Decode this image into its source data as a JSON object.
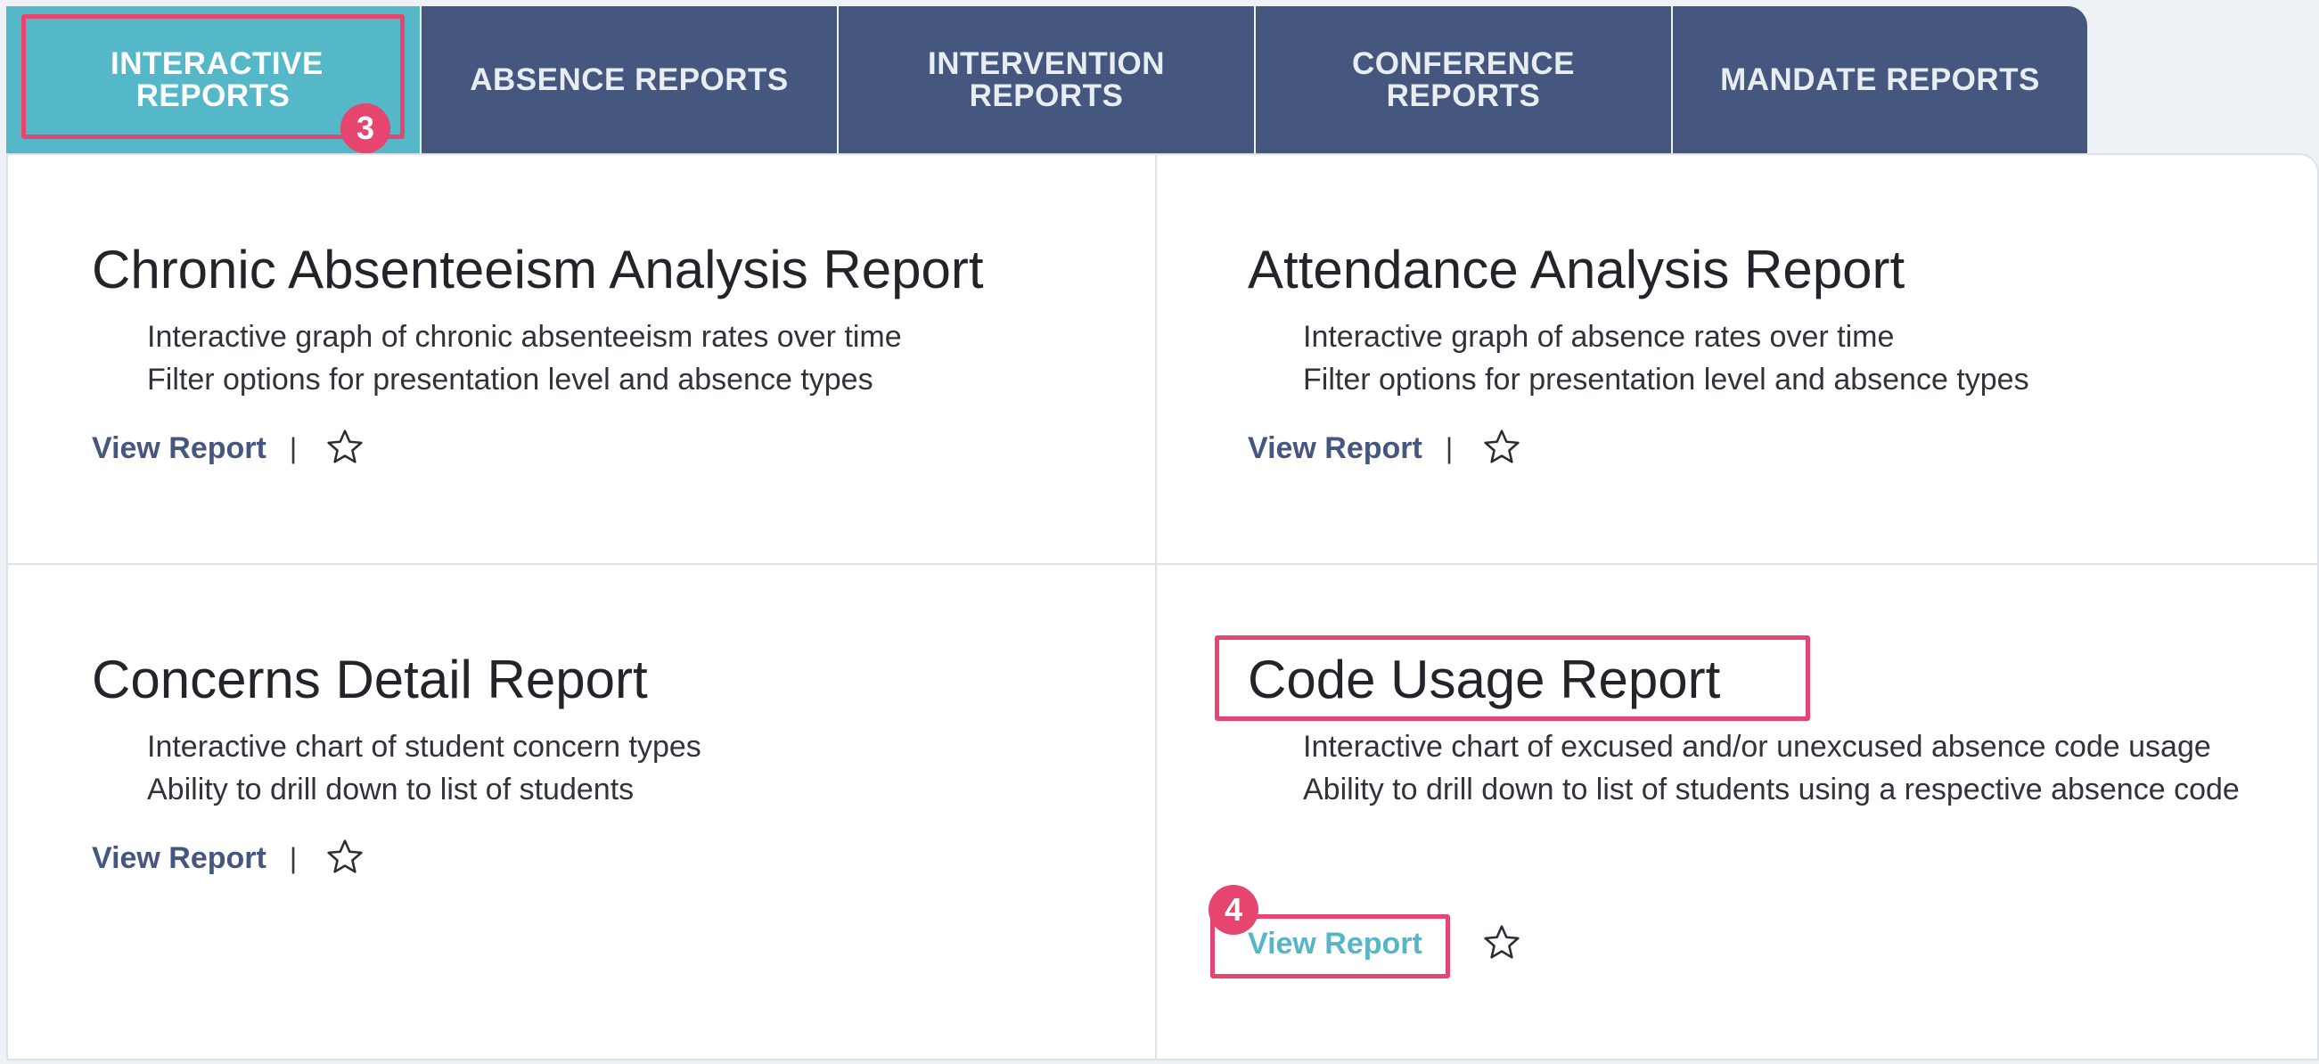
{
  "tabs": [
    {
      "label": "INTERACTIVE REPORTS"
    },
    {
      "label": "ABSENCE REPORTS"
    },
    {
      "label": "INTERVENTION REPORTS"
    },
    {
      "label": "CONFERENCE REPORTS"
    },
    {
      "label": "MANDATE REPORTS"
    }
  ],
  "reports": [
    {
      "title": "Chronic Absenteeism Analysis Report",
      "lines": [
        "Interactive graph of chronic absenteeism rates over time",
        "Filter options for presentation level and absence types"
      ],
      "link": "View Report",
      "separator": "|"
    },
    {
      "title": "Attendance Analysis Report",
      "lines": [
        "Interactive graph of absence rates over time",
        "Filter options for presentation level and absence types"
      ],
      "link": "View Report",
      "separator": "|"
    },
    {
      "title": "Concerns Detail Report",
      "lines": [
        "Interactive chart of student concern types",
        "Ability to drill down to list of students"
      ],
      "link": "View Report",
      "separator": "|"
    },
    {
      "title": "Code Usage Report",
      "lines": [
        "Interactive chart of excused and/or unexcused absence code usage",
        "Ability to drill down to list of students using a respective absence code"
      ],
      "link": "View Report"
    }
  ],
  "annotations": {
    "badge_tab": "3",
    "badge_link": "4"
  },
  "colors": {
    "tab_bg": "#45577e",
    "tab_active": "#55b8c9",
    "highlight": "#e5456e",
    "link": "#45577e",
    "link_active": "#56b6c6"
  }
}
